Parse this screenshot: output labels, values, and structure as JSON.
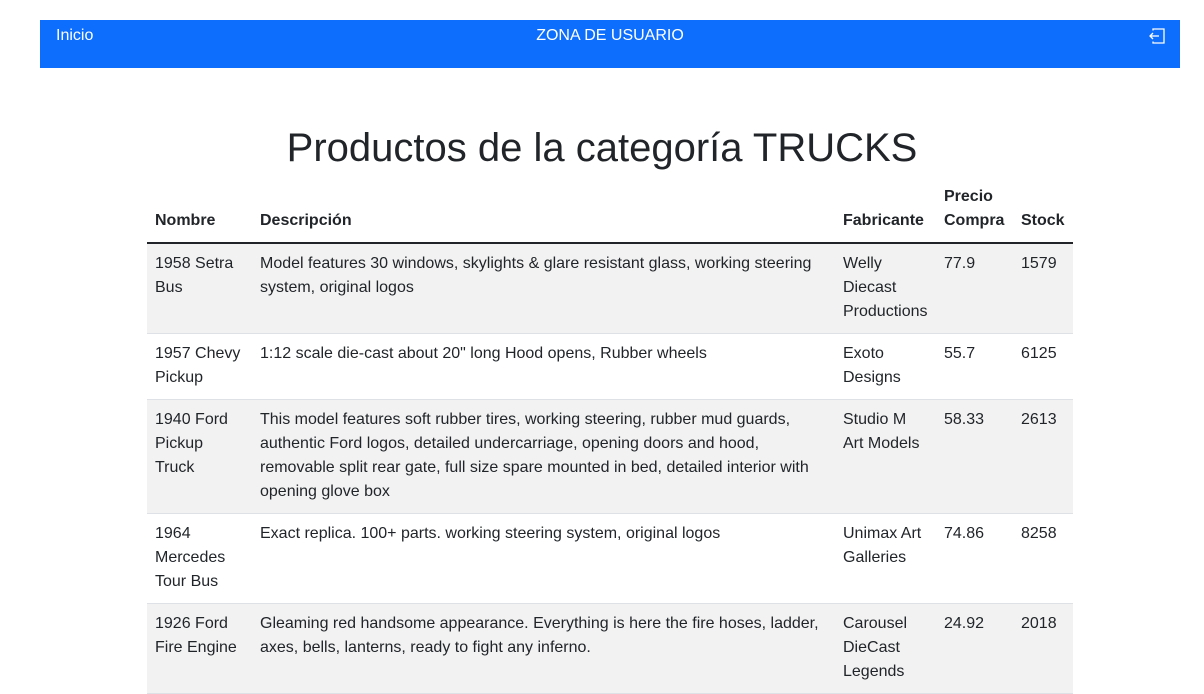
{
  "nav": {
    "home_label": "Inicio",
    "title": "ZONA DE USUARIO",
    "logout_icon": "logout-icon"
  },
  "page": {
    "heading": "Productos de la categoría TRUCKS"
  },
  "table": {
    "headers": {
      "nombre": "Nombre",
      "descripcion": "Descripción",
      "fabricante": "Fabricante",
      "precio_line1": "Precio",
      "precio_line2": "Compra",
      "stock": "Stock"
    },
    "rows": [
      {
        "nombre": "1958 Setra Bus",
        "descripcion": "Model features 30 windows, skylights & glare resistant glass, working steering system, original logos",
        "fabricante": "Welly Diecast Productions",
        "precio": "77.9",
        "stock": "1579"
      },
      {
        "nombre": "1957 Chevy Pickup",
        "descripcion": "1:12 scale die-cast about 20\" long Hood opens, Rubber wheels",
        "fabricante": "Exoto Designs",
        "precio": "55.7",
        "stock": "6125"
      },
      {
        "nombre": "1940 Ford Pickup Truck",
        "descripcion": "This model features soft rubber tires, working steering, rubber mud guards, authentic Ford logos, detailed undercarriage, opening doors and hood, removable split rear gate, full size spare mounted in bed, detailed interior with opening glove box",
        "fabricante": "Studio M Art Models",
        "precio": "58.33",
        "stock": "2613"
      },
      {
        "nombre": "1964 Mercedes Tour Bus",
        "descripcion": "Exact replica. 100+ parts. working steering system, original logos",
        "fabricante": "Unimax Art Galleries",
        "precio": "74.86",
        "stock": "8258"
      },
      {
        "nombre": "1926 Ford Fire Engine",
        "descripcion": "Gleaming red handsome appearance. Everything is here the fire hoses, ladder, axes, bells, lanterns, ready to fight any inferno.",
        "fabricante": "Carousel DieCast Legends",
        "precio": "24.92",
        "stock": "2018"
      }
    ]
  }
}
